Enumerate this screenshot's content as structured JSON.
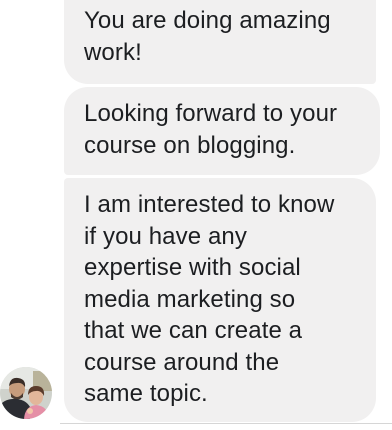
{
  "conversation": {
    "messages": [
      {
        "text": "You are doing amazing\nwork!"
      },
      {
        "text": "Looking forward to your\ncourse on blogging."
      },
      {
        "text": "I am interested to know\nif you have any\nexpertise with social\nmedia marketing so\nthat we can create a\ncourse around the\nsame topic."
      }
    ],
    "avatar": {
      "icon": "sender-profile-photo"
    }
  },
  "colors": {
    "bubble_background": "#f1f0f0",
    "text": "#1c1e21",
    "page_background": "#ffffff"
  }
}
